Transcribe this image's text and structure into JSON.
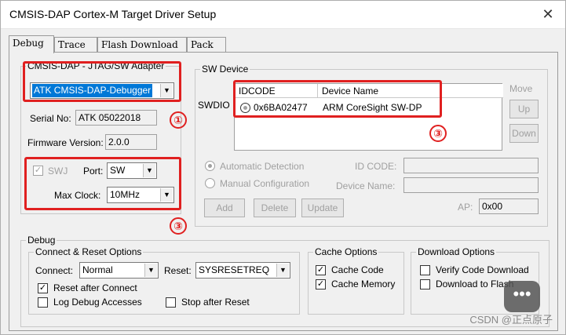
{
  "window": {
    "title": "CMSIS-DAP Cortex-M Target Driver Setup",
    "close_glyph": "✕"
  },
  "tabs": [
    "Debug",
    "Trace",
    "Flash Download",
    "Pack"
  ],
  "adapter": {
    "legend": "CMSIS-DAP - JTAG/SW Adapter",
    "selected": "ATK CMSIS-DAP-Debugger",
    "serial_label": "Serial No:",
    "serial_value": "ATK 05022018",
    "firmware_label": "Firmware Version:",
    "firmware_value": "2.0.0",
    "swj_label": "SWJ",
    "port_label": "Port:",
    "port_value": "SW",
    "maxclock_label": "Max Clock:",
    "maxclock_value": "10MHz"
  },
  "swdevice": {
    "legend": "SW Device",
    "row_label": "SWDIO",
    "col_idcode": "IDCODE",
    "col_name": "Device Name",
    "idcode": "0x6BA02477",
    "device_name": "ARM CoreSight SW-DP",
    "move_label": "Move",
    "up_label": "Up",
    "down_label": "Down",
    "auto_label": "Automatic Detection",
    "manual_label": "Manual Configuration",
    "idcode_field_label": "ID CODE:",
    "devname_field_label": "Device Name:",
    "add_label": "Add",
    "delete_label": "Delete",
    "update_label": "Update",
    "ap_label": "AP:",
    "ap_value": "0x00"
  },
  "debug": {
    "legend": "Debug",
    "connect_group": "Connect & Reset Options",
    "connect_label": "Connect:",
    "connect_value": "Normal",
    "reset_label": "Reset:",
    "reset_value": "SYSRESETREQ",
    "reset_after_connect": "Reset after Connect",
    "log_debug": "Log Debug Accesses",
    "stop_after_reset": "Stop after Reset",
    "cache_group": "Cache Options",
    "cache_code": "Cache Code",
    "cache_memory": "Cache Memory",
    "download_group": "Download Options",
    "verify_code": "Verify Code Download",
    "download_flash": "Download to Flash"
  },
  "markers": [
    "①",
    "③",
    "③"
  ],
  "watermark": "CSDN @正点原子",
  "check_glyph": "✓",
  "arrow_glyph": "▼",
  "colors": {
    "highlight_box": "#e02020",
    "selection": "#0078d7"
  }
}
